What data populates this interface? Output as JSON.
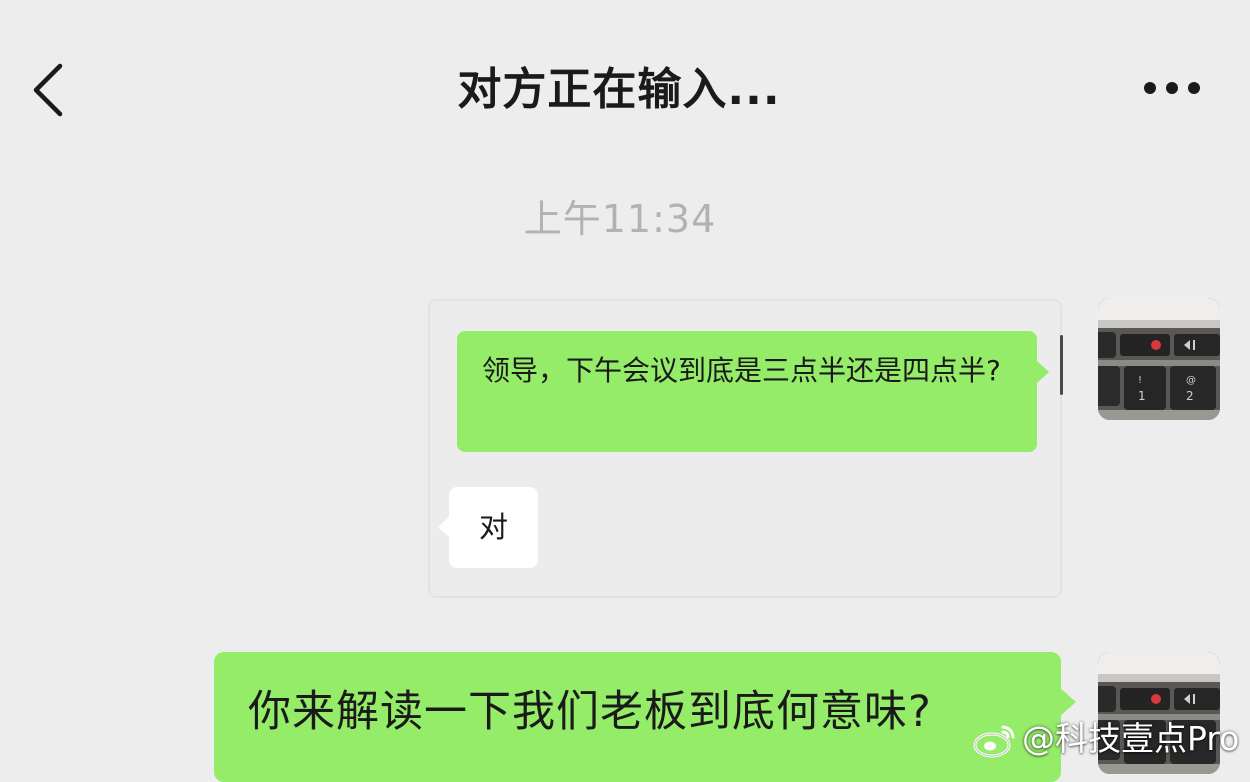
{
  "header": {
    "title": "对方正在输入...",
    "back_icon": "chevron-left-icon",
    "more_icon": "more-horizontal-icon"
  },
  "chat": {
    "timestamp": "上午11:34",
    "messages": [
      {
        "type": "image-screenshot",
        "from": "me",
        "inner_outgoing_text": "领导，下午会议到底是三点半还是四点半?",
        "inner_reply_text": "对"
      },
      {
        "type": "text",
        "from": "me",
        "text": "你来解读一下我们老板到底何意味?"
      }
    ]
  },
  "watermark": {
    "icon": "weibo-icon",
    "text": "@科技壹点Pro"
  },
  "colors": {
    "background": "#ededed",
    "bubble_green": "#95ec69",
    "bubble_white": "#ffffff",
    "timestamp": "#b2b2b2"
  }
}
